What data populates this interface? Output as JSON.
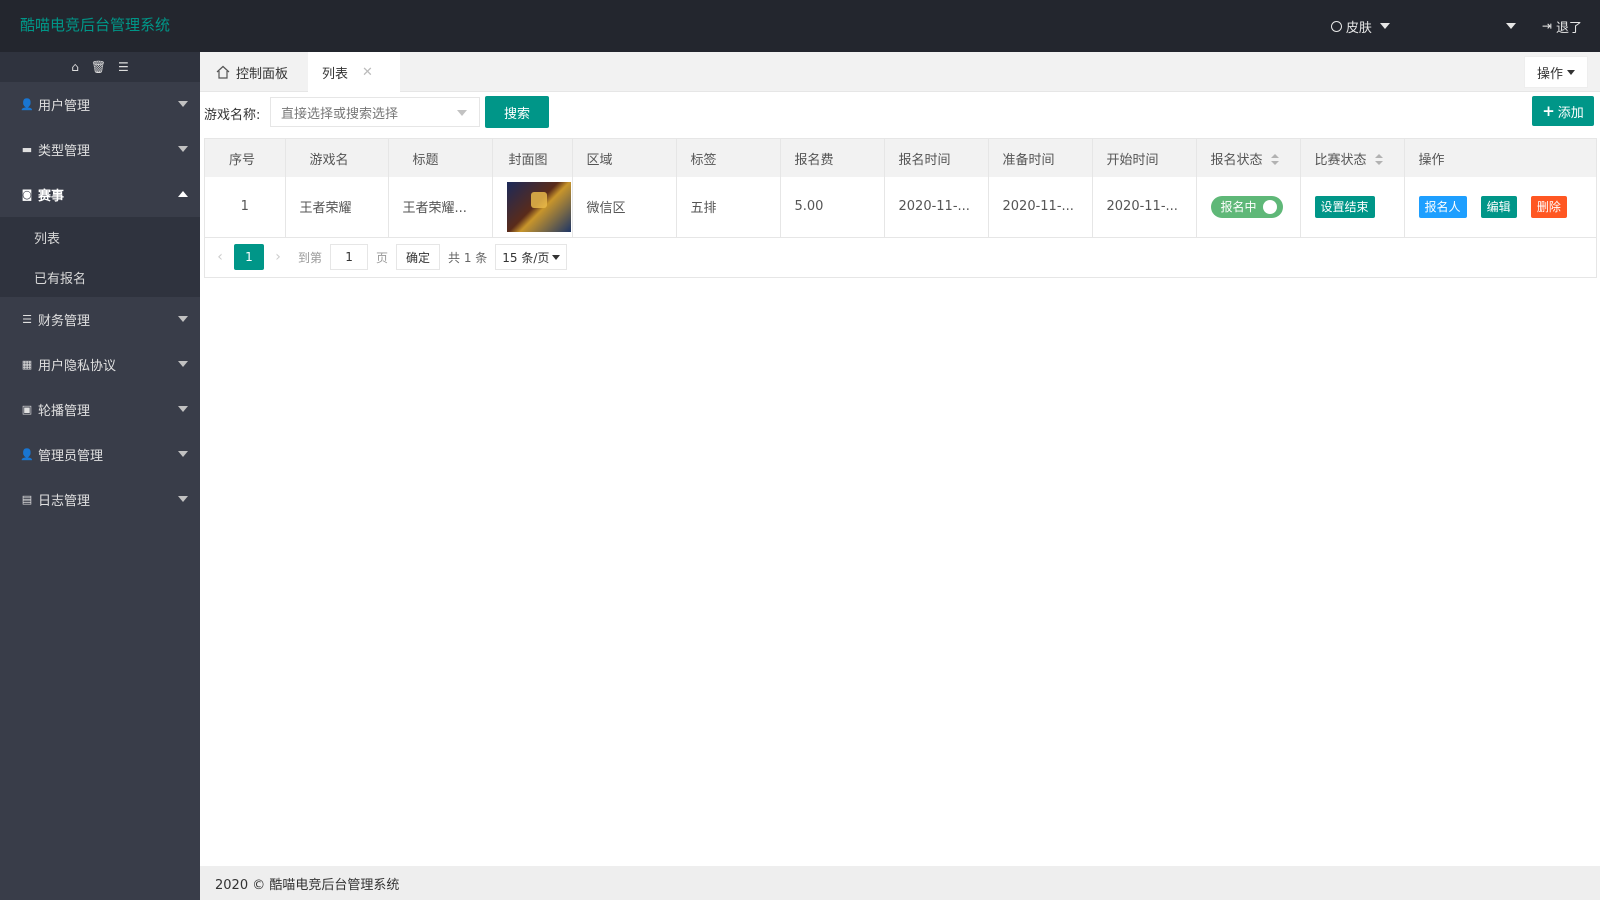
{
  "app": {
    "title": "酷喵电竞后台管理系统"
  },
  "header": {
    "skin_label": "皮肤",
    "logout_label": "退了"
  },
  "sidebar": {
    "tools": [
      "home-icon",
      "trash-icon",
      "menu-icon"
    ],
    "items": [
      {
        "label": "用户管理",
        "icon": "user-icon",
        "expanded": false
      },
      {
        "label": "类型管理",
        "icon": "folder-icon",
        "expanded": false
      },
      {
        "label": "赛事",
        "icon": "gamepad-icon",
        "expanded": true,
        "children": [
          {
            "label": "列表"
          },
          {
            "label": "已有报名"
          }
        ]
      },
      {
        "label": "财务管理",
        "icon": "list-icon",
        "expanded": false
      },
      {
        "label": "用户隐私协议",
        "icon": "calendar-icon",
        "expanded": false
      },
      {
        "label": "轮播管理",
        "icon": "image-icon",
        "expanded": false
      },
      {
        "label": "管理员管理",
        "icon": "user-icon",
        "expanded": false
      },
      {
        "label": "日志管理",
        "icon": "book-icon",
        "expanded": false
      }
    ]
  },
  "tabs": {
    "home_label": "控制面板",
    "list_label": "列表",
    "ops_label": "操作"
  },
  "search": {
    "label": "游戏名称:",
    "placeholder": "直接选择或搜索选择",
    "button": "搜索",
    "add_button": "添加"
  },
  "table": {
    "columns": [
      "序号",
      "游戏名",
      "标题",
      "封面图",
      "区域",
      "标签",
      "报名费",
      "报名时间",
      "准备时间",
      "开始时间",
      "报名状态",
      "比赛状态",
      "操作"
    ],
    "rows": [
      {
        "index": "1",
        "game": "王者荣耀",
        "title": "王者荣耀...",
        "region": "微信区",
        "tag": "五排",
        "fee": "5.00",
        "signup_time": "2020-11-...",
        "prepare_time": "2020-11-...",
        "start_time": "2020-11-...",
        "signup_status": "报名中",
        "match_status_button": "设置结束",
        "actions": [
          "报名人",
          "编辑",
          "删除"
        ]
      }
    ]
  },
  "pager": {
    "current": "1",
    "goto_label": "到第",
    "goto_value": "1",
    "page_suffix": "页",
    "confirm": "确定",
    "total": "共 1 条",
    "page_size": "15 条/页"
  },
  "footer": {
    "text": "2020 © 酷喵电竞后台管理系统"
  },
  "colors": {
    "accent": "#009688",
    "header_bg": "#23262e",
    "sidebar_bg": "#393d49",
    "switch_on": "#5fb878",
    "blue": "#1e9fff",
    "danger": "#ff5722"
  }
}
